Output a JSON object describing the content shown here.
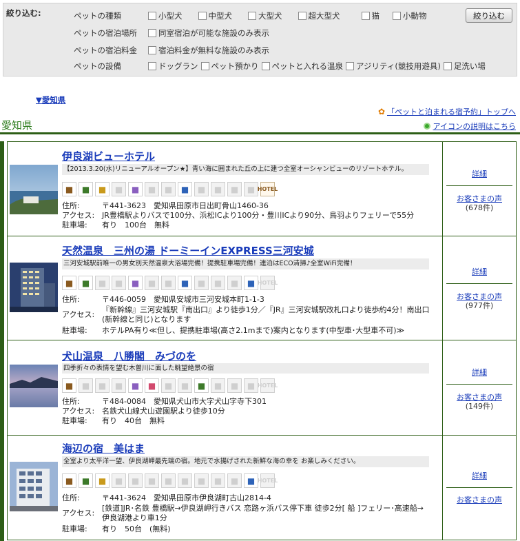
{
  "filter": {
    "title": "絞り込む:",
    "button": "絞り込む",
    "rows": [
      {
        "label": "ペットの種類",
        "options": [
          "小型犬",
          "中型犬",
          "大型犬",
          "超大型犬",
          "猫",
          "小動物"
        ]
      },
      {
        "label": "ペットの宿泊場所",
        "options": [
          "同室宿泊が可能な施設のみ表示"
        ]
      },
      {
        "label": "ペットの宿泊料金",
        "options": [
          "宿泊料金が無料な施設のみ表示"
        ]
      },
      {
        "label": "ペットの設備",
        "options": [
          "ドッグラン",
          "ペット預かり",
          "ペットと入れる温泉",
          "アジリティ(競技用遊具)",
          "足洗い場"
        ]
      }
    ]
  },
  "anchor": "▼愛知県",
  "top_link": "「ペットと泊まれる宿予約」トップへ",
  "pref_title": "愛知県",
  "icon_link": "アイコンの説明はこちら",
  "labels": {
    "address": "住所:",
    "access": "アクセス:",
    "parking": "駐車場:",
    "detail": "詳細",
    "voice": "お客さまの声",
    "hotel_icon": "HOTEL"
  },
  "hotels": [
    {
      "name": "伊良湖ビューホテル",
      "catch": "【2013.3.20(水)リニューアルオープン★】青い海に囲まれた丘の上に建つ全室オーシャンビューのリゾートホテル。",
      "address": "〒441-3623　愛知県田原市日出町骨山1460-36",
      "access": "JR豊橋駅よりバスで100分、浜松ICより100分・豊川ICより90分、鳥羽よりフェリーで55分",
      "parking": "有り　100台　無料",
      "reviews": "(678件)",
      "icons": [
        "brown",
        "green",
        "gold",
        "off",
        "purple",
        "off",
        "off",
        "blue",
        "off",
        "off",
        "off",
        "off",
        "hotel-on"
      ]
    },
    {
      "name": "天然温泉　三州の湯  ドーミーインEXPRESS三河安城",
      "catch": "三河安城駅前唯一の男女別天然温泉大浴場完備！提携駐車場完備！連泊はECO清掃♪全室WiFi完備！",
      "address": "〒446-0059　愛知県安城市三河安城本町1-1-3",
      "access": "『新幹線』三河安城駅『南出口』より徒歩1分／『JR』三河安城駅改札口より徒歩約4分！南出口(新幹線と同じ)となります",
      "parking": "ホテルPA有り≪但し、提携駐車場(高さ2.1mまで)案内となります(中型車･大型車不可)≫",
      "reviews": "(977件)",
      "icons": [
        "brown",
        "green",
        "off",
        "off",
        "purple",
        "off",
        "off",
        "blue",
        "off",
        "off",
        "off",
        "blue",
        "hotel-off"
      ]
    },
    {
      "name": "犬山温泉　八勝閣　みづのを",
      "catch": "四季折々の表情を望む木曽川に面した眺望絶景の宿",
      "address": "〒484-0084　愛知県犬山市大字犬山字寺下301",
      "access": "名鉄犬山線犬山遊園駅より徒歩10分",
      "parking": "有り　40台　無料",
      "reviews": "(149件)",
      "icons": [
        "brown",
        "off",
        "off",
        "off",
        "purple",
        "red",
        "off",
        "off",
        "green",
        "off",
        "off",
        "off",
        "hotel-off"
      ]
    },
    {
      "name": "海辺の宿　美はま",
      "catch": "全室より太平洋一望、伊良湖岬最先端の宿。地元で水揚げされた新鮮な海の幸を お楽しみください。",
      "address": "〒441-3624　愛知県田原市伊良湖町古山2814-4",
      "access": "[鉄道]JR･名鉄 豊橋駅→伊良湖岬行きバス 恋路ヶ浜バス停下車 徒歩2分[ 船 ]フェリー･高速船→伊良湖港より車1分",
      "parking": "有り　50台　(無料)",
      "reviews": "",
      "icons": [
        "brown",
        "green",
        "gold",
        "off",
        "off",
        "off",
        "off",
        "off",
        "off",
        "off",
        "off",
        "blue",
        "hotel-off"
      ]
    }
  ]
}
